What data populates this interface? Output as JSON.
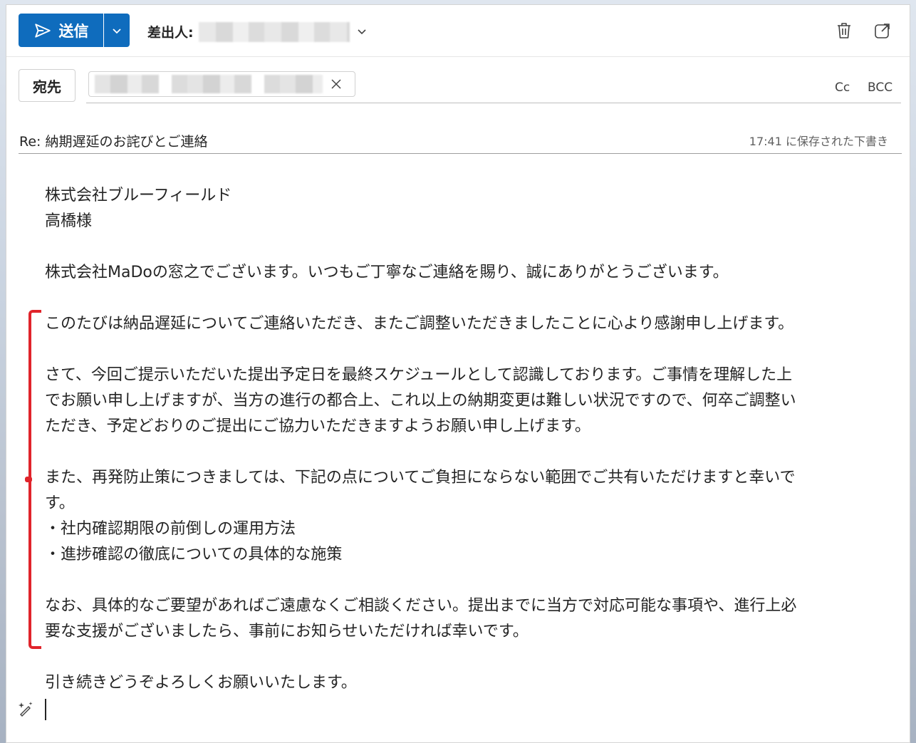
{
  "toolbar": {
    "send_label": "送信",
    "from_label": "差出人:"
  },
  "recipients": {
    "to_label": "宛先",
    "cc_label": "Cc",
    "bcc_label": "BCC"
  },
  "subject": {
    "text": "Re: 納期遅延のお詫びとご連絡",
    "saved_note": "17:41 に保存された下書き"
  },
  "body": {
    "greeting_company": "株式会社ブルーフィールド",
    "greeting_name": "高橋様",
    "intro": "株式会社MaDoの窓之でございます。いつもご丁寧なご連絡を賜り、誠にありがとうございます。",
    "para1": "このたびは納品遅延についてご連絡いただき、またご調整いただきましたことに心より感謝申し上げます。",
    "para2_l1": "さて、今回ご提示いただいた提出予定日を最終スケジュールとして認識しております。ご事情を理解した上",
    "para2_l2": "でお願い申し上げますが、当方の進行の都合上、これ以上の納期変更は難しい状況ですので、何卒ご調整い",
    "para2_l3": "ただき、予定どおりのご提出にご協力いただきますようお願い申し上げます。",
    "para3_l1": "また、再発防止策につきましては、下記の点についてご負担にならない範囲でご共有いただけますと幸いで",
    "para3_l2": "す。",
    "bullet1": "・社内確認期限の前倒しの運用方法",
    "bullet2": "・進捗確認の徹底についての具体的な施策",
    "para4_l1": "なお、具体的なご要望があればご遠慮なくご相談ください。提出までに当方で対応可能な事項や、進行上必",
    "para4_l2": "要な支援がございましたら、事前にお知らせいただければ幸いです。",
    "closing": "引き続きどうぞよろしくお願いいたします。"
  },
  "colors": {
    "accent": "#0f6cbd",
    "highlight_bracket": "#e0242b"
  }
}
